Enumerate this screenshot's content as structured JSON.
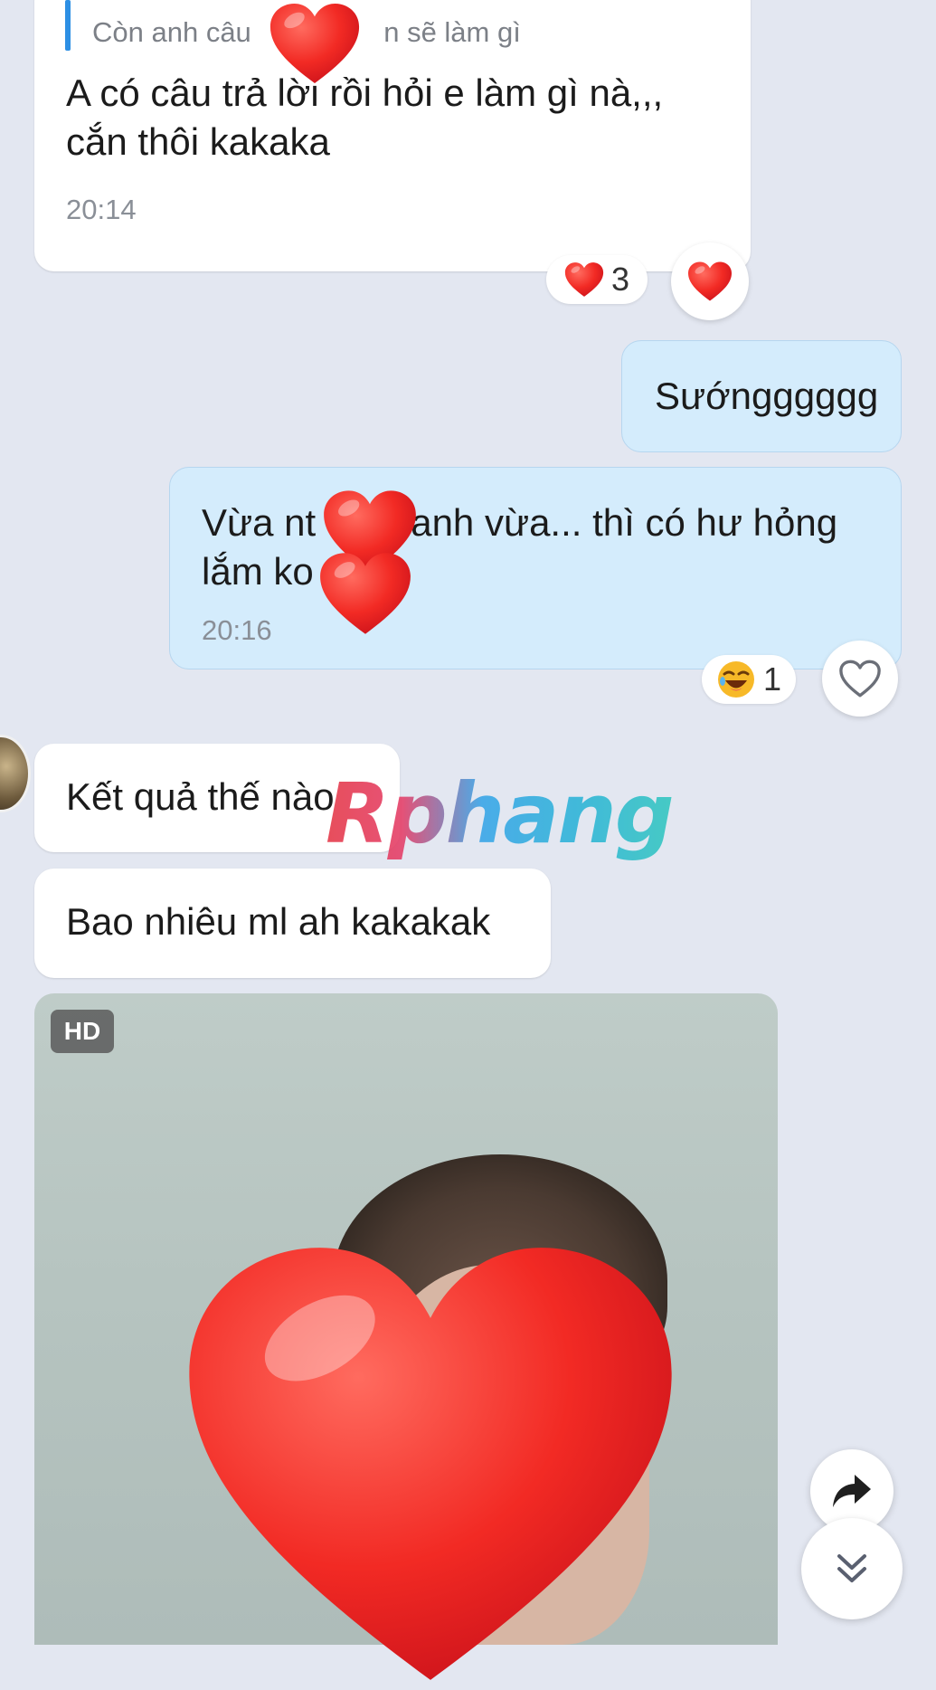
{
  "messages": {
    "m1": {
      "quote_text": "Còn anh câu                 n sẽ làm gì",
      "text": "A có câu trả lời rồi hỏi e làm gì nà,,,\ncắn thôi kakaka",
      "time": "20:14",
      "reaction_count": "3"
    },
    "m2": {
      "text": "Sướngggggg"
    },
    "m3": {
      "text": "Vừa nt         anh vừa... thì có hư hỏng\nlắm ko",
      "time": "20:16",
      "reaction_count": "1"
    },
    "m4": {
      "text": "Kết quả thế nào"
    },
    "m5": {
      "text": "Bao nhiêu ml ah kakakak"
    },
    "photo": {
      "badge": "HD"
    }
  },
  "watermark": "Rphang",
  "colors": {
    "background": "#e3e7f1",
    "outgoing_bubble": "#d4ecfc",
    "incoming_bubble": "#ffffff",
    "quote_accent": "#2d8fe4",
    "heart_red": "#e8141e"
  },
  "icons": {
    "reaction_heart": "heart-icon",
    "reaction_laugh": "laughing-emoji-icon",
    "like_button": "heart-outline-icon",
    "share": "share-arrow-icon",
    "scroll_down": "double-chevron-down-icon"
  }
}
